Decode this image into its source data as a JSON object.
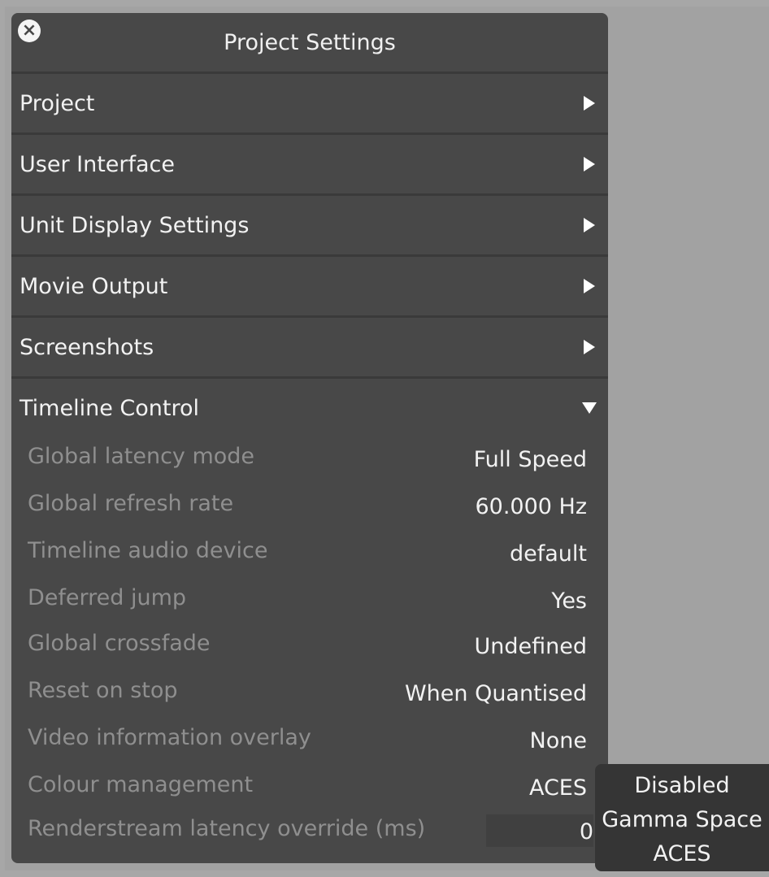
{
  "window": {
    "title": "Project Settings",
    "close_icon": "close-circle-icon"
  },
  "sections": [
    {
      "label": "Project",
      "expanded": false
    },
    {
      "label": "User Interface",
      "expanded": false
    },
    {
      "label": "Unit Display Settings",
      "expanded": false
    },
    {
      "label": "Movie Output",
      "expanded": false
    },
    {
      "label": "Screenshots",
      "expanded": false
    },
    {
      "label": "Timeline Control",
      "expanded": true
    }
  ],
  "timeline_control": {
    "rows": [
      {
        "label": "Global latency mode",
        "value": "Full Speed"
      },
      {
        "label": "Global refresh rate",
        "value": "60.000 Hz"
      },
      {
        "label": "Timeline audio device",
        "value": "default"
      },
      {
        "label": "Deferred jump",
        "value": "Yes"
      },
      {
        "label": "Global crossfade",
        "value": "Undefined"
      },
      {
        "label": "Reset on stop",
        "value": "When Quantised"
      },
      {
        "label": "Video information overlay",
        "value": "None"
      },
      {
        "label": "Colour management",
        "value": "ACES"
      }
    ],
    "latency_override": {
      "label": "Renderstream latency override (ms)",
      "value": "0"
    }
  },
  "colour_dropdown": {
    "options": [
      "Disabled",
      "Gamma Space",
      "ACES"
    ]
  },
  "colors": {
    "panel_bg": "#484848",
    "label_dim": "#8f8f8f",
    "value_text": "#f2f2f2"
  }
}
